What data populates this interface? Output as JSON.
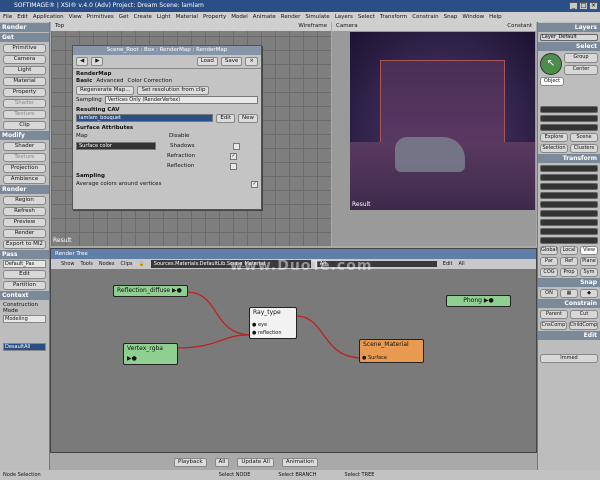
{
  "app": {
    "title": "SOFTIMAGE® | XSI® v.4.0 (Adv) Project: Dream    Scene: lamlam"
  },
  "menu": [
    "File",
    "Edit",
    "Application",
    "View",
    "Primitives",
    "Get",
    "Create",
    "Light",
    "Material",
    "Property",
    "Model",
    "Animate",
    "Render",
    "Simulate",
    "Layers",
    "Select",
    "Transform",
    "Constrain",
    "Snap",
    "Window",
    "Help"
  ],
  "left": {
    "render_title": "Render",
    "get_title": "Get",
    "get_buttons": [
      "Primitive",
      "Camera",
      "Light",
      "Material",
      "Property",
      "Shader",
      "Texture",
      "Clip"
    ],
    "modify_title": "Modify",
    "modify_buttons": [
      "Shader",
      "Texture",
      "Projection",
      "Ambience"
    ],
    "render2_title": "Render",
    "render_buttons": [
      "Region",
      "Refresh",
      "Preview",
      "Render",
      "Export to MI2"
    ],
    "pass_title": "Pass",
    "pass_value": "Default_Pas",
    "pass_buttons": [
      "Edit",
      "Partition"
    ],
    "context_title": "Context",
    "construction_label": "Construction Mode",
    "construction_value": "Modeling",
    "bottom_value": "DesaultAll"
  },
  "viewports": {
    "top_label": "Top",
    "top_mode": "Wireframe",
    "cam_label": "Camera",
    "cam_mode": "Constant",
    "result_label": "Result",
    "result_label2": "Result"
  },
  "dialog": {
    "title": "Scene_Root : Box : RenderMap : RenderMap",
    "load": "Load",
    "save": "Save",
    "section": "RenderMap",
    "tabs": [
      "Basic",
      "Advanced",
      "Color Correction"
    ],
    "regen": "Regenerate Map...",
    "setres": "Set resolution from clip",
    "sampling_label": "Sampling",
    "sampling_value": "Vertices Only (RenderVertex)",
    "cav_title": "Resulting CAV",
    "cav_value": "lamlam_bouquet",
    "edit": "Edit",
    "new": "New",
    "surface_title": "Surface Attributes",
    "map_label": "Map",
    "disable_label": "Disable",
    "map_value": "Surface color",
    "shadows": "Shadows",
    "refraction": "Refraction",
    "reflection": "Reflection",
    "sampling_title": "Sampling",
    "avg": "Average colors around vertices"
  },
  "tree": {
    "title": "Render Tree",
    "menus": [
      "Show",
      "Tools",
      "Nodes",
      "Clips"
    ],
    "path": "Sources.Materials.DefaultLib.Scene_Material",
    "filter": "All",
    "edit": "Edit",
    "all": "All",
    "nodes": {
      "reflection": "Reflection_diffuse",
      "vertex": "Vertex_rgba",
      "raytype": "Ray_type",
      "eye": "eye",
      "refl": "reflection",
      "material": "Scene_Material",
      "surface": "Surface",
      "phong": "Phong"
    }
  },
  "right": {
    "layers_title": "Layers",
    "layer_value": "Layer_Default",
    "select_title": "Select",
    "group": "Group",
    "center": "Center",
    "object": "Object",
    "explore": "Explore",
    "scene": "Scene",
    "selection": "Selection",
    "clusters": "Clusters",
    "transform_title": "Transform",
    "global": "Global",
    "local": "Local",
    "view": "View",
    "par": "Par",
    "ref": "Ref",
    "plane": "Plane",
    "cog": "COG",
    "prop": "Prop",
    "sym": "Sym",
    "snap_title": "Snap",
    "on": "ON",
    "constrain_title": "Constrain",
    "parent": "Parent",
    "cut": "Cut",
    "cnscomp": "CnsComp",
    "childcomp": "ChildComp",
    "edit_title": "Edit",
    "immed": "Immed"
  },
  "status": [
    "Node Selection",
    "Select NODE",
    "Select BRANCH",
    "Select TREE"
  ],
  "bottom_bar": {
    "playback": "Playback",
    "all": "All",
    "update_all": "Update All",
    "animation": "Animation"
  },
  "watermark": "www.DuoTe.com"
}
